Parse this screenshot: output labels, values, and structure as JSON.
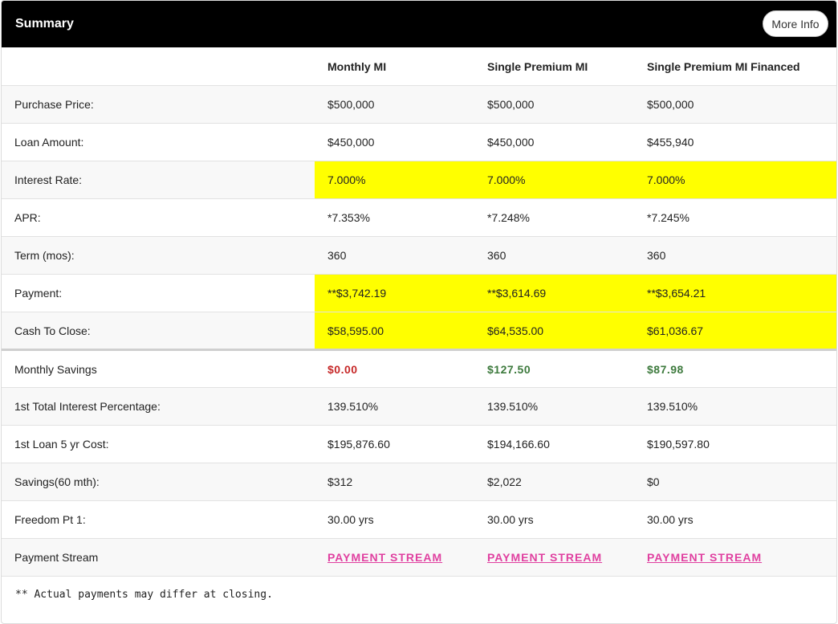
{
  "header": {
    "title": "Summary",
    "more_info_label": "More Info"
  },
  "columns": [
    "",
    "Monthly MI",
    "Single Premium MI",
    "Single Premium MI Financed"
  ],
  "rows": [
    {
      "label": "Purchase Price:",
      "values": [
        "$500,000",
        "$500,000",
        "$500,000"
      ]
    },
    {
      "label": "Loan Amount:",
      "values": [
        "$450,000",
        "$450,000",
        "$455,940"
      ]
    },
    {
      "label": "Interest Rate:",
      "values": [
        "7.000%",
        "7.000%",
        "7.000%"
      ]
    },
    {
      "label": "APR:",
      "values": [
        "*7.353%",
        "*7.248%",
        "*7.245%"
      ]
    },
    {
      "label": "Term (mos):",
      "values": [
        "360",
        "360",
        "360"
      ]
    },
    {
      "label": "Payment:",
      "values": [
        "**$3,742.19",
        "**$3,614.69",
        "**$3,654.21"
      ]
    },
    {
      "label": "Cash To Close:",
      "values": [
        "$58,595.00",
        "$64,535.00",
        "$61,036.67"
      ]
    },
    {
      "label": "Monthly Savings",
      "values": [
        "$0.00",
        "$127.50",
        "$87.98"
      ]
    },
    {
      "label": "1st Total Interest Percentage:",
      "values": [
        "139.510%",
        "139.510%",
        "139.510%"
      ]
    },
    {
      "label": "1st Loan 5 yr Cost:",
      "values": [
        "$195,876.60",
        "$194,166.60",
        "$190,597.80"
      ]
    },
    {
      "label": "Savings(60 mth):",
      "values": [
        "$312",
        "$2,022",
        "$0"
      ]
    },
    {
      "label": "Freedom Pt 1:",
      "values": [
        "30.00 yrs",
        "30.00 yrs",
        "30.00 yrs"
      ]
    },
    {
      "label": "Payment Stream",
      "values": [
        "PAYMENT STREAM",
        "PAYMENT STREAM",
        "PAYMENT STREAM"
      ]
    }
  ],
  "highlight_color": "#ffff00",
  "savings_colors": {
    "zero": "#c62828",
    "positive": "#3d7a3d"
  },
  "link_color": "#e040a0",
  "footnote": "** Actual payments may differ at closing."
}
